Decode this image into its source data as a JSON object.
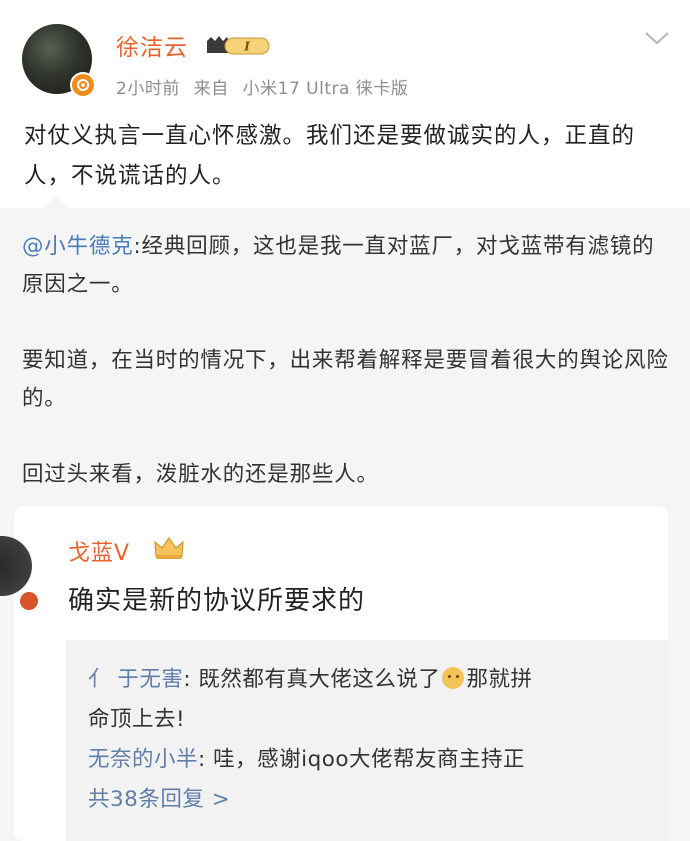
{
  "post": {
    "author": "徐洁云",
    "vip_level": "I",
    "time": "2小时前",
    "source_prefix": "来自",
    "source_device": "小米17 Ultra 徕卡版",
    "text": "对仗义执言一直心怀感激。我们还是要做诚实的人，正直的人，不说谎话的人。"
  },
  "quote": {
    "mention": "@小牛德克",
    "para1": ":经典回顾，这也是我一直对蓝厂，对戈蓝带有滤镜的原因之一。",
    "para2": "要知道，在当时的情况下，出来帮着解释是要冒着很大的舆论风险的。",
    "para3": "回过头来看，泼脏水的还是那些人。"
  },
  "inner_post": {
    "author": "戈蓝V",
    "text": "确实是新的协议所要求的",
    "replies": [
      {
        "name": "亻 于无害",
        "text": ": 既然都有真大佬这么说了",
        "text2": "那就拼",
        "text3": "命顶上去!"
      },
      {
        "name": "无奈的小半",
        "text": ": 哇，感谢iqoo大佬帮友商主持正"
      }
    ],
    "more_replies": "共38条回复 >"
  },
  "colors": {
    "accent": "#e8632e",
    "link": "#4a7cb8",
    "muted": "#8e8e8e"
  }
}
